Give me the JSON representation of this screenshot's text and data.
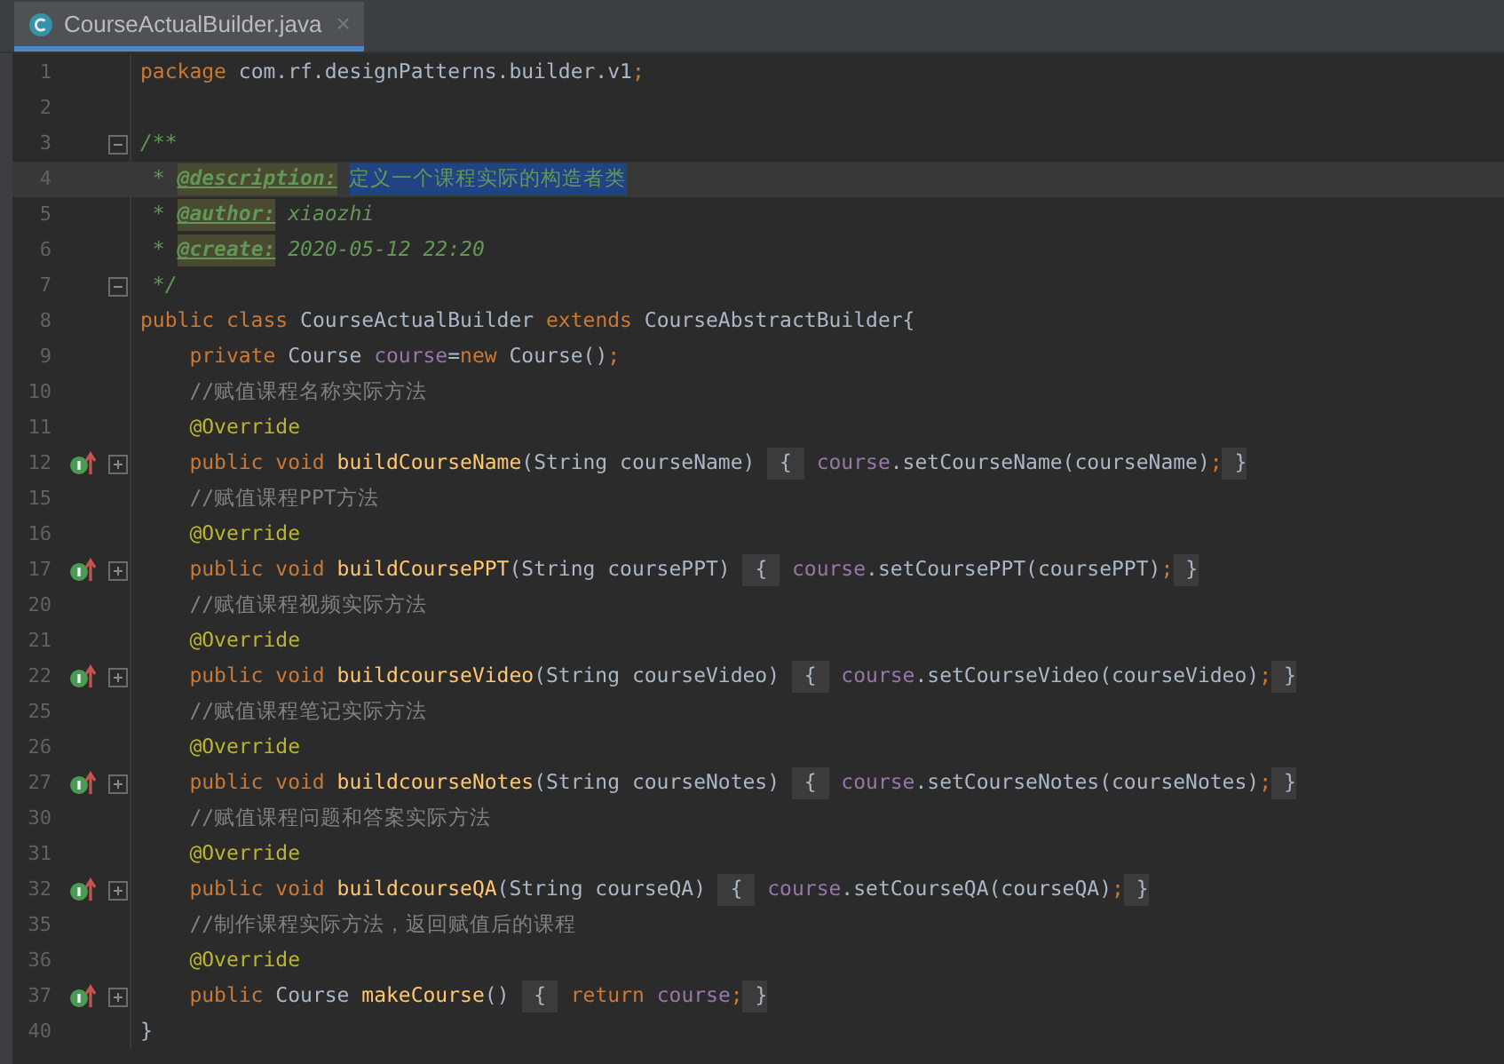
{
  "tabs": [
    {
      "label": "CourseActualBuilder.java",
      "selected": true,
      "close": "×"
    }
  ],
  "lines": [
    {
      "number": "1",
      "current": false,
      "override": false,
      "tokens": [
        {
          "t": "package ",
          "kind": "kw"
        },
        {
          "t": "com.rf.designPatterns.builder.v1",
          "kind": "text"
        },
        {
          "t": ";",
          "kind": "kw"
        }
      ]
    },
    {
      "number": "2",
      "current": false,
      "override": false
    },
    {
      "number": "3",
      "current": false,
      "override": false,
      "expanded": true,
      "tokens": [
        {
          "t": "/**",
          "kind": "doc"
        }
      ]
    },
    {
      "number": "4",
      "current": true,
      "override": false,
      "tokens": [
        {
          "t": " * ",
          "kind": "doc"
        },
        {
          "t": "@description:",
          "kind": "doctag"
        },
        {
          "t": "定义一个课程实际的构造者类",
          "kind": "selected"
        }
      ]
    },
    {
      "number": "5",
      "current": false,
      "override": false,
      "tokens": [
        {
          "t": " * ",
          "kind": "doc"
        },
        {
          "t": "@author:",
          "kind": "doctag"
        },
        {
          "t": " xiaozhi",
          "kind": "doc"
        }
      ]
    },
    {
      "number": "6",
      "current": false,
      "override": false,
      "tokens": [
        {
          "t": " * ",
          "kind": "doc"
        },
        {
          "t": "@create:",
          "kind": "doctag"
        },
        {
          "t": " 2020-05-12 22:20",
          "kind": "doc"
        }
      ]
    },
    {
      "number": "7",
      "current": false,
      "override": false,
      "expanded": true,
      "tokens": [
        {
          "t": " */",
          "kind": "doc"
        }
      ]
    },
    {
      "number": "8",
      "current": false,
      "override": false,
      "tokens": [
        {
          "t": "public class ",
          "kind": "kw"
        },
        {
          "t": "CourseActualBuilder ",
          "kind": "text"
        },
        {
          "t": "extends ",
          "kind": "kw"
        },
        {
          "t": "CourseAbstractBuilder{",
          "kind": "text"
        }
      ]
    },
    {
      "number": "9",
      "current": false,
      "override": false,
      "tokens": [
        {
          "t": "    private ",
          "kind": "kw"
        },
        {
          "t": "Course ",
          "kind": "text"
        },
        {
          "t": "course",
          "kind": "field"
        },
        {
          "t": "=",
          "kind": "text"
        },
        {
          "t": "new ",
          "kind": "kw"
        },
        {
          "t": "Course()",
          "kind": "text"
        },
        {
          "t": ";",
          "kind": "kw"
        }
      ]
    },
    {
      "number": "10",
      "current": false,
      "override": false,
      "tokens": [
        {
          "t": "    //赋值课程名称实际方法",
          "kind": "comment"
        }
      ]
    },
    {
      "number": "11",
      "current": false,
      "override": false,
      "tokens": [
        {
          "t": "    @Override",
          "kind": "ann"
        }
      ]
    },
    {
      "number": "12",
      "current": false,
      "override": true,
      "expanded": false,
      "tokens": [
        {
          "t": "    public void ",
          "kind": "kw"
        },
        {
          "t": "buildCourseName",
          "kind": "method"
        },
        {
          "t": "(String courseName) ",
          "kind": "text"
        },
        {
          "t": " { ",
          "kind": "folded"
        },
        {
          "t": "course",
          "kind": "field"
        },
        {
          "t": ".setCourseName(courseName)",
          "kind": "text"
        },
        {
          "t": ";",
          "kind": "kw"
        },
        {
          "t": " }",
          "kind": "folded"
        }
      ]
    },
    {
      "number": "15",
      "current": false,
      "override": false,
      "tokens": [
        {
          "t": "    //赋值课程PPT方法",
          "kind": "comment"
        }
      ]
    },
    {
      "number": "16",
      "current": false,
      "override": false,
      "tokens": [
        {
          "t": "    @Override",
          "kind": "ann"
        }
      ]
    },
    {
      "number": "17",
      "current": false,
      "override": true,
      "expanded": false,
      "tokens": [
        {
          "t": "    public void ",
          "kind": "kw"
        },
        {
          "t": "buildCoursePPT",
          "kind": "method"
        },
        {
          "t": "(String coursePPT) ",
          "kind": "text"
        },
        {
          "t": " { ",
          "kind": "folded"
        },
        {
          "t": "course",
          "kind": "field"
        },
        {
          "t": ".setCoursePPT(coursePPT)",
          "kind": "text"
        },
        {
          "t": ";",
          "kind": "kw"
        },
        {
          "t": " }",
          "kind": "folded"
        }
      ]
    },
    {
      "number": "20",
      "current": false,
      "override": false,
      "tokens": [
        {
          "t": "    //赋值课程视频实际方法",
          "kind": "comment"
        }
      ]
    },
    {
      "number": "21",
      "current": false,
      "override": false,
      "tokens": [
        {
          "t": "    @Override",
          "kind": "ann"
        }
      ]
    },
    {
      "number": "22",
      "current": false,
      "override": true,
      "expanded": false,
      "tokens": [
        {
          "t": "    public void ",
          "kind": "kw"
        },
        {
          "t": "buildcourseVideo",
          "kind": "method"
        },
        {
          "t": "(String courseVideo) ",
          "kind": "text"
        },
        {
          "t": " { ",
          "kind": "folded"
        },
        {
          "t": "course",
          "kind": "field"
        },
        {
          "t": ".setCourseVideo(courseVideo)",
          "kind": "text"
        },
        {
          "t": ";",
          "kind": "kw"
        },
        {
          "t": " }",
          "kind": "folded"
        }
      ]
    },
    {
      "number": "25",
      "current": false,
      "override": false,
      "tokens": [
        {
          "t": "    //赋值课程笔记实际方法",
          "kind": "comment"
        }
      ]
    },
    {
      "number": "26",
      "current": false,
      "override": false,
      "tokens": [
        {
          "t": "    @Override",
          "kind": "ann"
        }
      ]
    },
    {
      "number": "27",
      "current": false,
      "override": true,
      "expanded": false,
      "tokens": [
        {
          "t": "    public void ",
          "kind": "kw"
        },
        {
          "t": "buildcourseNotes",
          "kind": "method"
        },
        {
          "t": "(String courseNotes) ",
          "kind": "text"
        },
        {
          "t": " { ",
          "kind": "folded"
        },
        {
          "t": "course",
          "kind": "field"
        },
        {
          "t": ".setCourseNotes(courseNotes)",
          "kind": "text"
        },
        {
          "t": ";",
          "kind": "kw"
        },
        {
          "t": " }",
          "kind": "folded"
        }
      ]
    },
    {
      "number": "30",
      "current": false,
      "override": false,
      "tokens": [
        {
          "t": "    //赋值课程问题和答案实际方法",
          "kind": "comment"
        }
      ]
    },
    {
      "number": "31",
      "current": false,
      "override": false,
      "tokens": [
        {
          "t": "    @Override",
          "kind": "ann"
        }
      ]
    },
    {
      "number": "32",
      "current": false,
      "override": true,
      "expanded": false,
      "tokens": [
        {
          "t": "    public void ",
          "kind": "kw"
        },
        {
          "t": "buildcourseQA",
          "kind": "method"
        },
        {
          "t": "(String courseQA) ",
          "kind": "text"
        },
        {
          "t": " { ",
          "kind": "folded"
        },
        {
          "t": "course",
          "kind": "field"
        },
        {
          "t": ".setCourseQA(courseQA)",
          "kind": "text"
        },
        {
          "t": ";",
          "kind": "kw"
        },
        {
          "t": " }",
          "kind": "folded"
        }
      ]
    },
    {
      "number": "35",
      "current": false,
      "override": false,
      "tokens": [
        {
          "t": "    //制作课程实际方法，返回赋值后的课程",
          "kind": "comment"
        }
      ]
    },
    {
      "number": "36",
      "current": false,
      "override": false,
      "tokens": [
        {
          "t": "    @Override",
          "kind": "ann"
        }
      ]
    },
    {
      "number": "37",
      "current": false,
      "override": true,
      "expanded": false,
      "tokens": [
        {
          "t": "    public ",
          "kind": "kw"
        },
        {
          "t": "Course ",
          "kind": "text"
        },
        {
          "t": "makeCourse",
          "kind": "method"
        },
        {
          "t": "() ",
          "kind": "text"
        },
        {
          "t": " { ",
          "kind": "folded"
        },
        {
          "t": "return ",
          "kind": "kw"
        },
        {
          "t": "course",
          "kind": "field"
        },
        {
          "t": ";",
          "kind": "kw"
        },
        {
          "t": " }",
          "kind": "folded"
        }
      ]
    },
    {
      "number": "40",
      "current": false,
      "override": false,
      "tokens": [
        {
          "t": "}",
          "kind": "text"
        }
      ]
    }
  ]
}
